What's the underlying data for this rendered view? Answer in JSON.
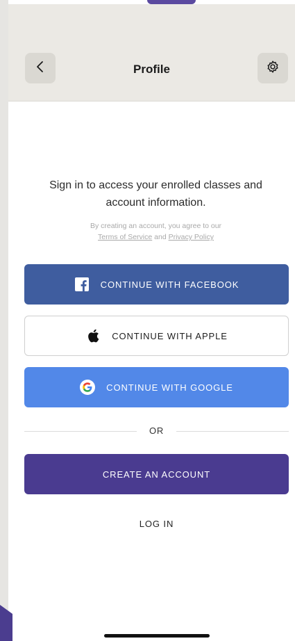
{
  "header": {
    "title": "Profile",
    "back_icon": "chevron-left-icon",
    "settings_icon": "gear-icon"
  },
  "intro": {
    "message": "Sign in to access your enrolled classes and account information.",
    "legal_prefix": "By creating an account, you agree to our",
    "terms_link": "Terms of Service",
    "legal_and": "and",
    "privacy_link": "Privacy Policy"
  },
  "auth": {
    "facebook_label": "CONTINUE WITH FACEBOOK",
    "apple_label": "CONTINUE WITH APPLE",
    "google_label": "CONTINUE WITH GOOGLE",
    "or_label": "OR",
    "create_label": "CREATE AN ACCOUNT",
    "login_label": "LOG IN"
  },
  "colors": {
    "facebook": "#3f5d9f",
    "google": "#5288e8",
    "primary": "#4a3b90",
    "header_bg": "#ebe9e4"
  }
}
